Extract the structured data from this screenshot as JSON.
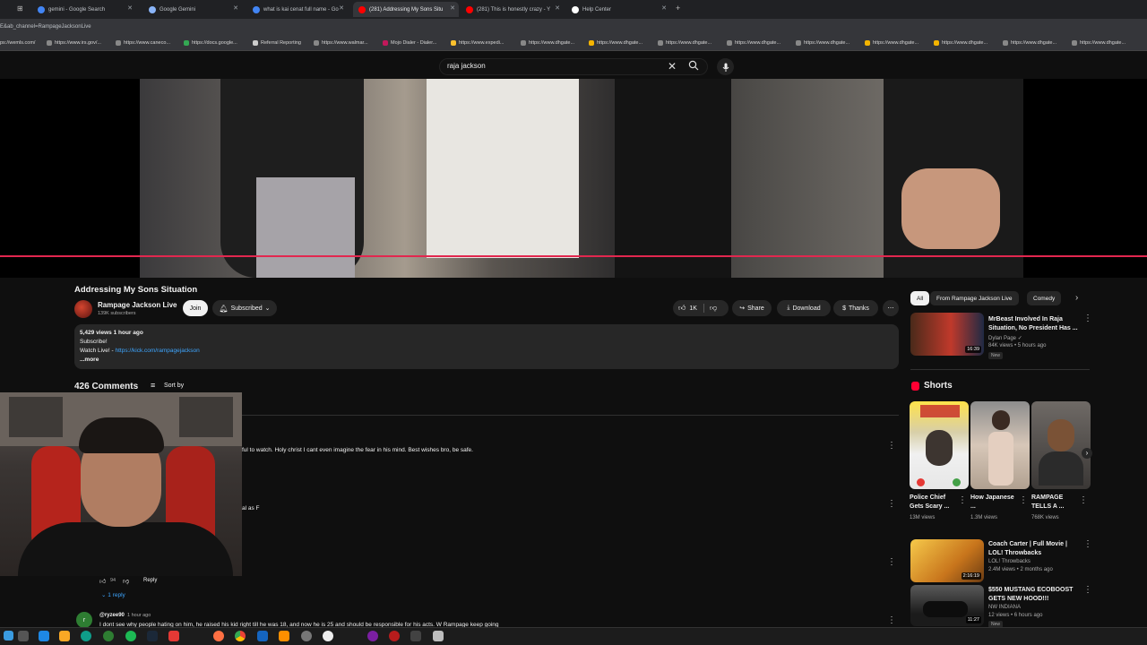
{
  "tabs": [
    {
      "label": "gemini - Google Search",
      "color": "#4285f4"
    },
    {
      "label": "Google Gemini",
      "color": "#8ab4f8"
    },
    {
      "label": "what is kai cenat full name - Go",
      "color": "#4285f4"
    },
    {
      "label": "(281) Addressing My Sons Situ",
      "color": "#ff0000"
    },
    {
      "label": "(281) This is honestly crazy - Y",
      "color": "#ff0000"
    },
    {
      "label": "Help Center",
      "color": "#ffffff"
    }
  ],
  "address": "E&ab_channel=RampageJacksonLive",
  "bookmarks": [
    "ps://wemls.com/",
    "https://www.irs.gov/...",
    "https://www.caneco...",
    "https://docs.google...",
    "Referral Reporting",
    "https://www.walmar...",
    "Mojo Dialer - Dialer...",
    "https://www.expedi...",
    "https://www.dhgate...",
    "https://www.dhgate...",
    "https://www.dhgate...",
    "https://www.dhgate...",
    "https://www.dhgate...",
    "https://www.dhgate...",
    "https://www.dhgate...",
    "https://www.dhgate...",
    "https://www.dhgate..."
  ],
  "search": {
    "query": "raja jackson"
  },
  "video": {
    "title": "Addressing My Sons Situation",
    "channel": "Rampage Jackson Live",
    "subscribers": "139K subscribers",
    "join": "Join",
    "subscribed": "Subscribed",
    "likes": "1K",
    "share": "Share",
    "download": "Download",
    "thanks": "Thanks"
  },
  "description": {
    "stats": "5,429 views  1 hour ago",
    "line1": "Subscribe!",
    "watch_label": "Watch Live! - ",
    "link": "https://kick.com/rampagejackson",
    "more": "...more"
  },
  "comments": {
    "count": "426 Comments",
    "sort": "Sort by",
    "c1_text": "ful to watch. Holy christ I cant even imagine the fear in his mind. Best wishes bro, be safe.",
    "c2_text": "al as F",
    "likes_count": "94",
    "reply": "Reply",
    "replies": "1 reply",
    "c3_author": "@ryzee90",
    "c3_time": "1 hour ago",
    "c3_avatar": "r",
    "c3_text": "I dont see why people hating on him, he raised his kid right till he was 18, and now he is 25 and should be responsible for his acts. W Rampage keep going"
  },
  "chips": [
    "All",
    "From Rampage Jackson Live",
    "Comedy"
  ],
  "recommended": [
    {
      "title": "MrBeast Involved In Raja Situation, No President Has ...",
      "channel": "Dylan Page",
      "meta": "84K views • 5 hours ago",
      "badge": "New",
      "duration": "16:39"
    }
  ],
  "shorts": {
    "heading": "Shorts",
    "items": [
      {
        "title": "Police Chief Gets Scary ...",
        "views": "13M views"
      },
      {
        "title": "How Japanese ...",
        "views": "1.3M views"
      },
      {
        "title": "RAMPAGE TELLS A ...",
        "views": "768K views"
      }
    ]
  },
  "more_videos": [
    {
      "title": "Coach Carter | Full Movie | LOL! Throwbacks",
      "channel": "LOL! Throwbacks",
      "meta": "2.4M views • 2 months ago",
      "duration": "2:16:19"
    },
    {
      "title": "$550 MUSTANG ECOBOOST GETS NEW HOOD!!!",
      "channel": "NW INDIANA",
      "meta": "12 views • 6 hours ago",
      "badge": "New",
      "duration": "11:27"
    }
  ]
}
